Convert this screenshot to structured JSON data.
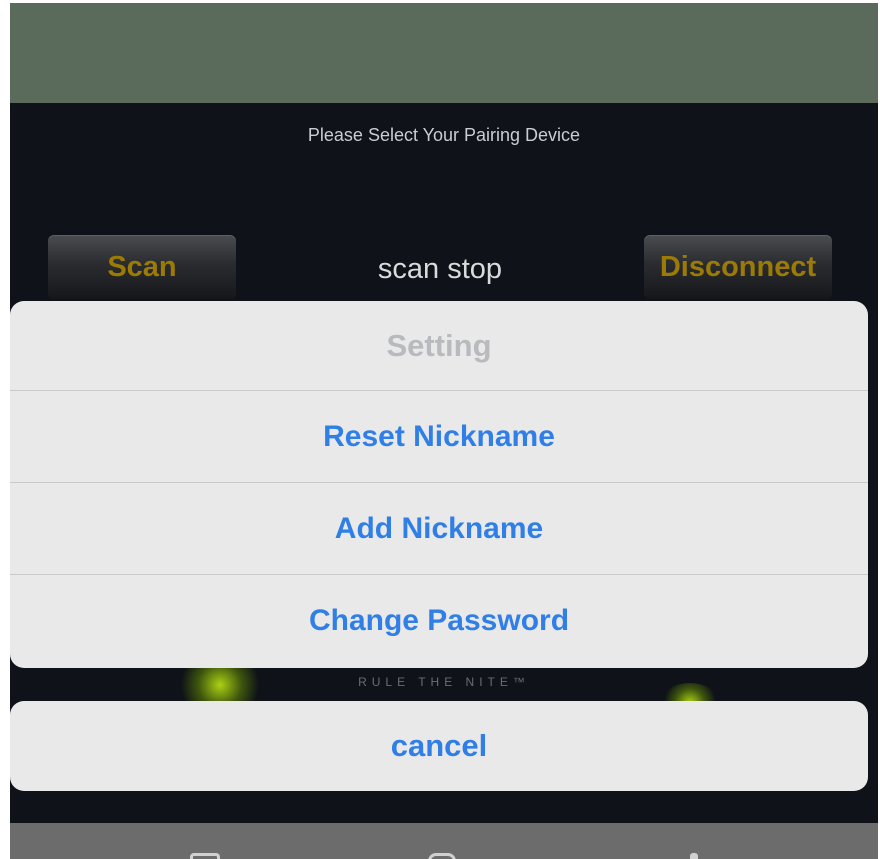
{
  "screen": {
    "subtitle": "Please Select Your Pairing Device",
    "scan_button": "Scan",
    "scan_status": "scan stop",
    "disconnect_button": "Disconnect",
    "brand_tagline": "RULE THE NITE™"
  },
  "action_sheet": {
    "title": "Setting",
    "items": [
      {
        "label": "Reset Nickname"
      },
      {
        "label": "Add Nickname"
      },
      {
        "label": "Change Password"
      }
    ],
    "cancel_label": "cancel"
  },
  "colors": {
    "accent": "#2f7fe6",
    "button_text_gold": "#9c7a06",
    "header_green": "#5a6b5c",
    "background": "#0f1218"
  }
}
